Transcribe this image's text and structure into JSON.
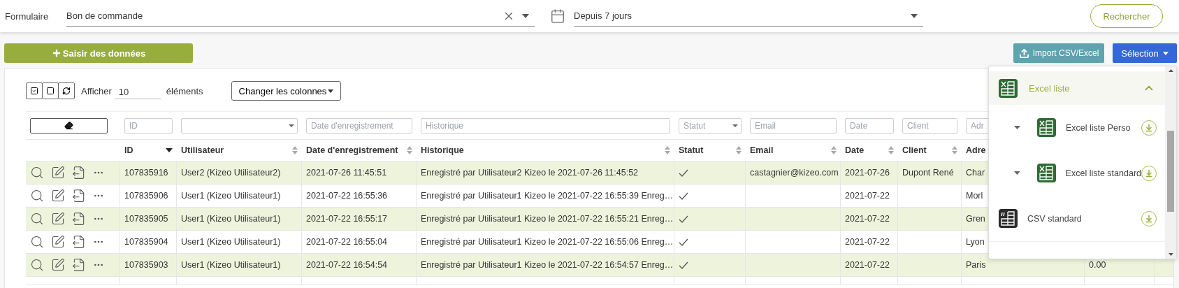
{
  "form_bar": {
    "label": "Formulaire",
    "form_field": {
      "value": "Bon de commande"
    },
    "period_field": {
      "value": "Depuis 7 jours"
    },
    "search_button": "Rechercher"
  },
  "actions": {
    "add_button": "Saisir des données",
    "import_button": "Import CSV/Excel",
    "selection_button": "Sélection"
  },
  "toolbar": {
    "show_label": "Afficher",
    "show_count": "10",
    "show_suffix": "éléments",
    "columns_button": "Changer les colonnes"
  },
  "table": {
    "filters": [
      {
        "kind": "clear"
      },
      {
        "kind": "text",
        "placeholder": "ID"
      },
      {
        "kind": "select"
      },
      {
        "kind": "text",
        "placeholder": "Date d'enregistrement"
      },
      {
        "kind": "text",
        "placeholder": "Historique"
      },
      {
        "kind": "select",
        "placeholder": "Statut"
      },
      {
        "kind": "text",
        "placeholder": "Email"
      },
      {
        "kind": "text",
        "placeholder": "Date"
      },
      {
        "kind": "text",
        "placeholder": "Client"
      },
      {
        "kind": "text",
        "placeholder": "Adr"
      }
    ],
    "columns": [
      {
        "label": "ID",
        "sorted": true
      },
      {
        "label": "Utilisateur",
        "sorted": false
      },
      {
        "label": "Date d'enregistrement",
        "sorted": false
      },
      {
        "label": "Historique",
        "sorted": false
      },
      {
        "label": "Statut",
        "sorted": false
      },
      {
        "label": "Email",
        "sorted": false
      },
      {
        "label": "Date",
        "sorted": false
      },
      {
        "label": "Client",
        "sorted": false
      },
      {
        "label": "Adre"
      }
    ],
    "rows": [
      {
        "id": "107835916",
        "user": "User2 (Kizeo Utilisateur2)",
        "saved_at": "2021-07-26 11:45:51",
        "history": "Enregistré par Utilisateur2 Kizeo le 2021-07-26 11:45:52",
        "validated": true,
        "email": "castagnier@kizeo.com",
        "date": "2021-07-26",
        "client": "Dupont René",
        "address": "Char",
        "column_11": ""
      },
      {
        "id": "107835906",
        "user": "User1 (Kizeo Utilisateur1)",
        "saved_at": "2021-07-22 16:55:36",
        "history": "Enregistré par Utilisateur1 Kizeo le 2021-07-22 16:55:39 Enreg…",
        "validated": true,
        "email": "",
        "date": "2021-07-22",
        "client": "",
        "address": "Morl",
        "column_11": ""
      },
      {
        "id": "107835905",
        "user": "User1 (Kizeo Utilisateur1)",
        "saved_at": "2021-07-22 16:55:17",
        "history": "Enregistré par Utilisateur1 Kizeo le 2021-07-22 16:55:21 Enreg…",
        "validated": true,
        "email": "",
        "date": "2021-07-22",
        "client": "",
        "address": "Gren",
        "column_11": ""
      },
      {
        "id": "107835904",
        "user": "User1 (Kizeo Utilisateur1)",
        "saved_at": "2021-07-22 16:55:04",
        "history": "Enregistré par Utilisateur1 Kizeo le 2021-07-22 16:55:06 Enreg…",
        "validated": true,
        "email": "",
        "date": "2021-07-22",
        "client": "",
        "address": "Lyon",
        "column_11": ""
      },
      {
        "id": "107835903",
        "user": "User1 (Kizeo Utilisateur1)",
        "saved_at": "2021-07-22 16:54:54",
        "history": "Enregistré par Utilisateur1 Kizeo le 2021-07-22 16:54:57 Enreg…",
        "validated": true,
        "email": "",
        "date": "2021-07-22",
        "client": "",
        "address": "Paris",
        "column_11": "0.00"
      }
    ]
  },
  "export_menu": {
    "items": [
      {
        "kind": "group",
        "label": "Excel liste",
        "expanded": true,
        "children": [
          {
            "kind": "excel",
            "label": "Excel liste Perso"
          },
          {
            "kind": "excel",
            "label": "Excel liste standard"
          }
        ]
      },
      {
        "kind": "csv",
        "label": "CSV standard"
      }
    ]
  }
}
